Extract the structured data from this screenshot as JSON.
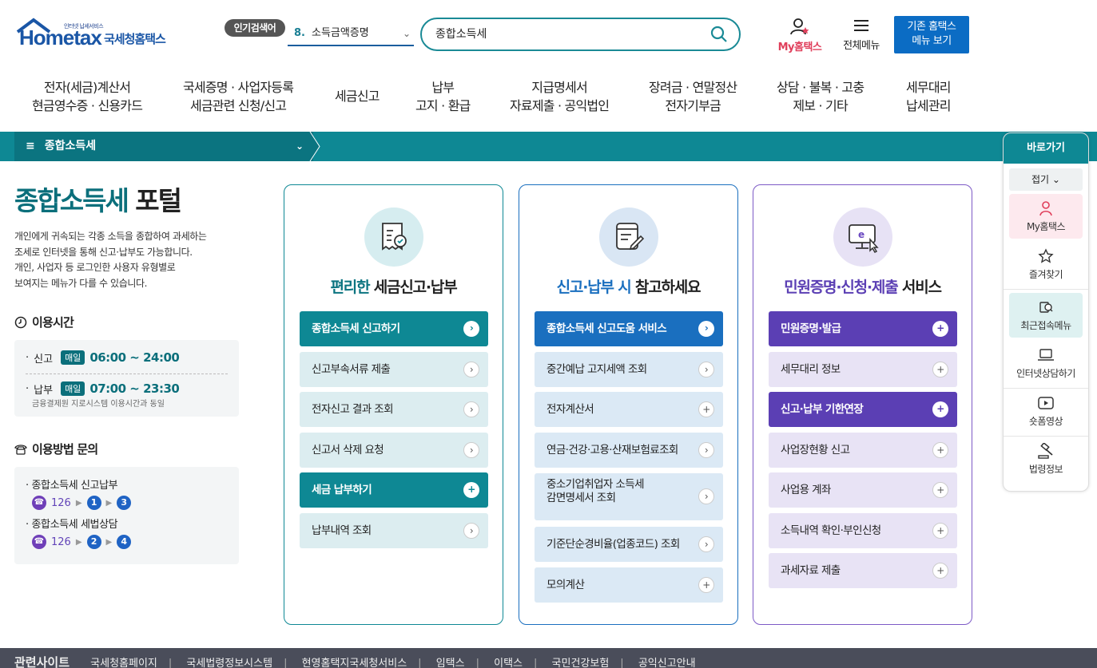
{
  "header": {
    "logo_small": "인터넷 납세서비스",
    "logo_home": "Hometax",
    "logo_kr": "국세청홈택스",
    "popular_badge": "인기검색어",
    "popular_rank": "8.",
    "popular_term": "소득금액증명",
    "search_value": "종합소득세",
    "my_hometax": "My홈택스",
    "all_menu": "전체메뉴",
    "old_hometax_line1": "기존 홈택스",
    "old_hometax_line2": "메뉴 보기"
  },
  "gnb": [
    {
      "l1": "전자(세금)계산서",
      "l2": "현금영수증 · 신용카드"
    },
    {
      "l1": "국세증명 · 사업자등록",
      "l2": "세금관련 신청/신고"
    },
    {
      "l1": "세금신고",
      "l2": ""
    },
    {
      "l1": "납부",
      "l2": "고지 · 환급"
    },
    {
      "l1": "지급명세서",
      "l2": "자료제출 · 공익법인"
    },
    {
      "l1": "장려금 · 연말정산",
      "l2": "전자기부금"
    },
    {
      "l1": "상담 · 불복 · 고충",
      "l2": "제보 · 기타"
    },
    {
      "l1": "세무대리",
      "l2": "납세관리"
    }
  ],
  "breadcrumb": {
    "current": "종합소득세"
  },
  "portal": {
    "title_hl": "종합소득세",
    "title_rest": " 포털",
    "desc": [
      "개인에게 귀속되는 각종 소득을 종합하여 과세하는",
      "조세로 인터넷을 통해 신고·납부도 가능합니다.",
      "개인, 사업자 등 로그인한 사용자 유형별로",
      "보여지는 메뉴가 다를 수 있습니다."
    ],
    "time_title": "이용시간",
    "time_rows": [
      {
        "label": "신고",
        "tag": "매일",
        "time": "06:00 ~ 24:00",
        "note": ""
      },
      {
        "label": "납부",
        "tag": "매일",
        "time": "07:00 ~ 23:30",
        "note": "금융결제원 지로시스템 이용시간과 동일"
      }
    ],
    "contact_title": "이용방법 문의",
    "contacts": [
      {
        "label": "종합소득세 신고납부",
        "phone": "126",
        "n1": "1",
        "n2": "3"
      },
      {
        "label": "종합소득세 세법상담",
        "phone": "126",
        "n1": "2",
        "n2": "4"
      }
    ]
  },
  "cards": [
    {
      "title_hl": "편리한",
      "title_rest": " 세금신고·납부",
      "items": [
        "종합소득세 신고하기",
        "신고부속서류 제출",
        "전자신고 결과 조회",
        "신고서 삭제 요청",
        "세금 납부하기",
        "납부내역 조회"
      ]
    },
    {
      "title_hl": "신고·납부 시",
      "title_rest": " 참고하세요",
      "items": [
        "종합소득세 신고도움 서비스",
        "중간예납 고지세액 조회",
        "전자계산서",
        "연금·건강·고용·산재보험료조회",
        "중소기업취업자 소득세",
        "감면명세서 조회",
        "기준단순경비율(업종코드) 조회",
        "모의계산"
      ]
    },
    {
      "title_hl": "민원증명·신청·제출",
      "title_rest": " 서비스",
      "items": [
        "민원증명·발급",
        "세무대리 정보",
        "신고·납부 기한연장",
        "사업장현황 신고",
        "사업용 계좌",
        "소득내역 확인·부인신청",
        "과세자료 제출"
      ]
    }
  ],
  "side": {
    "title": "바로가기",
    "fold": "접기",
    "items": [
      "My홈택스",
      "즐겨찾기",
      "최근접속메뉴",
      "인터넷상담하기",
      "숏폼영상",
      "법령정보"
    ]
  },
  "footer": {
    "title": "관련사이트",
    "links": [
      "국세청홈페이지",
      "국세법령정보시스템",
      "현영홈택지국세청서비스",
      "임택스",
      "이택스",
      "국민건강보험",
      "공익신고안내"
    ]
  },
  "colors": {
    "teal": "#0e8894",
    "blue": "#1a6fbf",
    "purple": "#5b3fb4",
    "pink": "#e0405c"
  }
}
